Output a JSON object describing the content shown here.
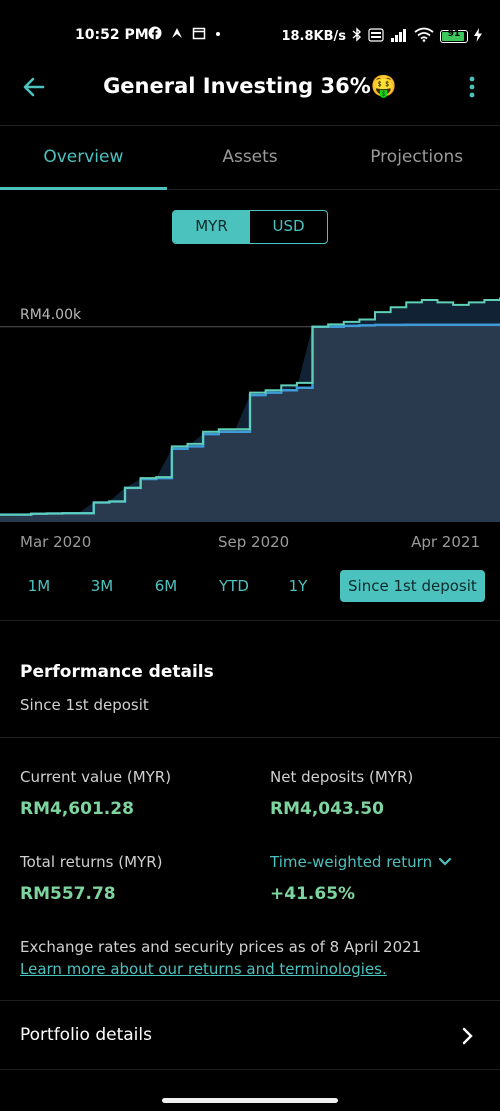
{
  "status_bar": {
    "time": "10:52 PM",
    "net_speed": "18.8KB/s",
    "battery": "91",
    "battery_level": 0.91,
    "icons": [
      "facebook-icon",
      "app-icon",
      "calendar-icon",
      "dot-icon",
      "bluetooth-icon",
      "volte-icon",
      "signal-icon",
      "wifi-icon",
      "battery-icon",
      "charging-icon"
    ]
  },
  "header": {
    "title": "General Investing 36%🤑"
  },
  "tabs": [
    {
      "label": "Overview",
      "active": true
    },
    {
      "label": "Assets",
      "active": false
    },
    {
      "label": "Projections",
      "active": false
    }
  ],
  "currency": {
    "options": [
      "MYR",
      "USD"
    ],
    "selected": "MYR"
  },
  "chart_data": {
    "type": "area",
    "reference_label": "RM4.00k",
    "reference_value": 4000,
    "x_tick_labels": [
      "Mar 2020",
      "Sep 2020",
      "Apr 2021"
    ],
    "series": [
      {
        "name": "",
        "color": "#5fd0b6",
        "values": [
          150,
          150,
          170,
          175,
          180,
          180,
          400,
          420,
          700,
          900,
          920,
          1550,
          1600,
          1850,
          1900,
          1900,
          2650,
          2700,
          2800,
          2850,
          4000,
          4050,
          4100,
          4150,
          4300,
          4400,
          4500,
          4550,
          4500,
          4450,
          4500,
          4550,
          4600
        ]
      },
      {
        "name": "",
        "color": "#3f9ad8",
        "values": [
          150,
          150,
          170,
          175,
          180,
          180,
          400,
          420,
          700,
          880,
          900,
          1500,
          1550,
          1800,
          1850,
          1850,
          2600,
          2650,
          2700,
          2750,
          4000,
          4000,
          4020,
          4030,
          4040,
          4040,
          4043,
          4043,
          4043,
          4043,
          4043,
          4043,
          4043
        ]
      }
    ],
    "ylim": [
      0,
      5000
    ],
    "colors": {
      "portfolio_line": "#5fd0b6",
      "deposit_line": "#3f9ad8",
      "area_fill": "#2e3f57"
    }
  },
  "ranges": [
    {
      "label": "1M",
      "active": false
    },
    {
      "label": "3M",
      "active": false
    },
    {
      "label": "6M",
      "active": false
    },
    {
      "label": "YTD",
      "active": false
    },
    {
      "label": "1Y",
      "active": false
    },
    {
      "label": "Since 1st deposit",
      "active": true
    }
  ],
  "performance": {
    "title": "Performance details",
    "subtitle": "Since 1st deposit",
    "current_value_label": "Current value (MYR)",
    "current_value": "RM4,601.28",
    "net_deposits_label": "Net deposits (MYR)",
    "net_deposits": "RM4,043.50",
    "total_returns_label": "Total returns (MYR)",
    "total_returns": "RM557.78",
    "twr_label": "Time-weighted return",
    "twr_value": "+41.65%",
    "note": "Exchange rates and security prices as of 8 April 2021",
    "learn_more": "Learn more about our returns and terminologies."
  },
  "portfolio": {
    "label": "Portfolio details"
  },
  "colors": {
    "accent": "#4cc2bf",
    "positive": "#7ed49e",
    "background": "#000000"
  }
}
